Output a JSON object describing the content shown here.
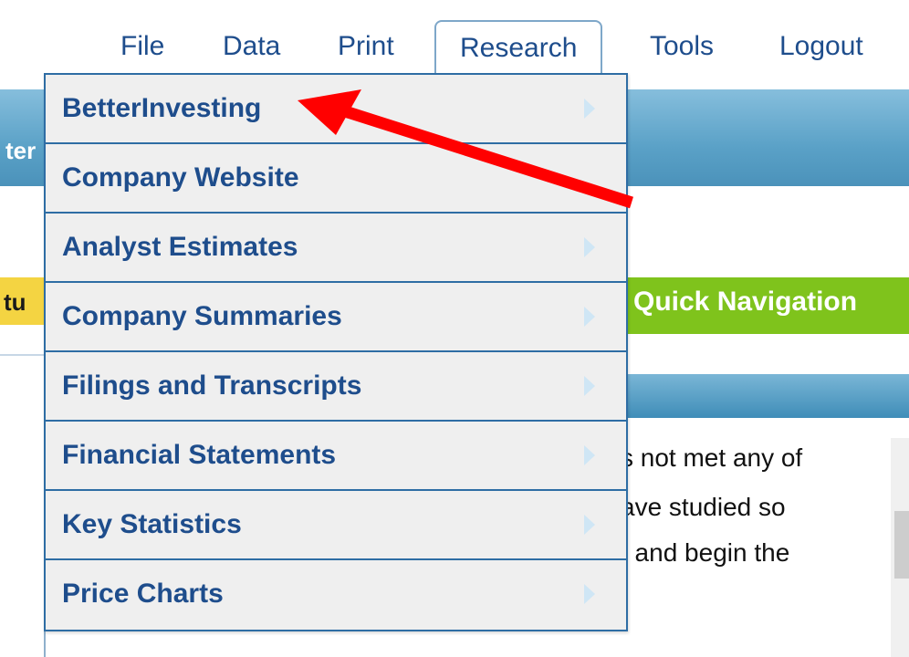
{
  "menubar": {
    "items": [
      {
        "label": "File"
      },
      {
        "label": "Data"
      },
      {
        "label": "Print"
      },
      {
        "label": "Research"
      },
      {
        "label": "Tools"
      },
      {
        "label": "Logout"
      }
    ],
    "active": "Research"
  },
  "research_menu": {
    "items": [
      {
        "label": "BetterInvesting",
        "has_submenu": true
      },
      {
        "label": "Company Website",
        "has_submenu": false
      },
      {
        "label": "Analyst Estimates",
        "has_submenu": true
      },
      {
        "label": "Company Summaries",
        "has_submenu": true
      },
      {
        "label": "Filings and Transcripts",
        "has_submenu": true
      },
      {
        "label": "Financial Statements",
        "has_submenu": true
      },
      {
        "label": "Key Statistics",
        "has_submenu": true
      },
      {
        "label": "Price Charts",
        "has_submenu": true
      }
    ]
  },
  "background": {
    "bluebar_text": "ter",
    "yellow_button_text": "tu",
    "quick_nav_label": "Quick Navigation",
    "body_lines": [
      "s not met any of",
      "ave studied so",
      "/ and begin the"
    ]
  },
  "annotation": {
    "icon": "red-arrow-icon",
    "color": "#ff0000",
    "points_to": "BetterInvesting"
  },
  "colors": {
    "menu_text": "#1e4d8c",
    "menu_border": "#2e6da4",
    "menu_bg": "#efefef",
    "bluebar": "#5aa1c7",
    "quick_nav": "#7fc31c",
    "yellow": "#f4d442"
  }
}
